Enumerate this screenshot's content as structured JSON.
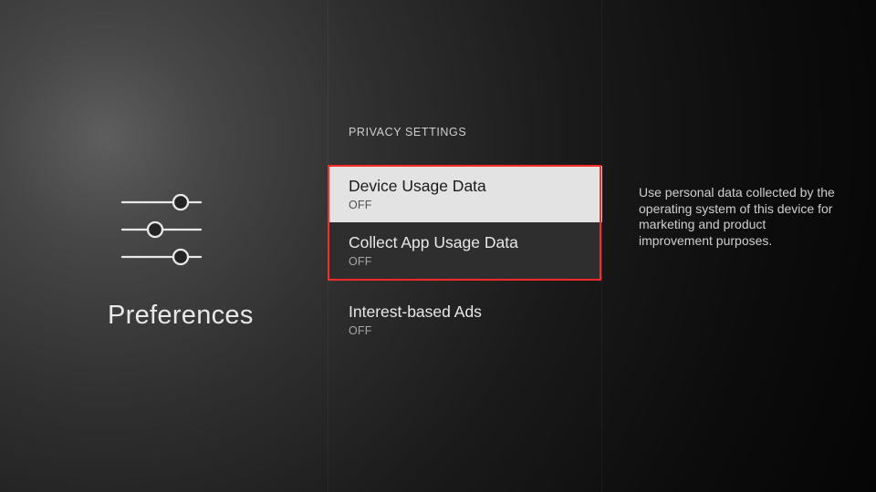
{
  "page_title": "Preferences",
  "section_heading": "PRIVACY SETTINGS",
  "options": [
    {
      "label": "Device Usage Data",
      "value": "OFF"
    },
    {
      "label": "Collect App Usage Data",
      "value": "OFF"
    },
    {
      "label": "Interest-based Ads",
      "value": "OFF"
    }
  ],
  "description": "Use personal data collected by the operating system of this device for marketing and product improvement purposes."
}
